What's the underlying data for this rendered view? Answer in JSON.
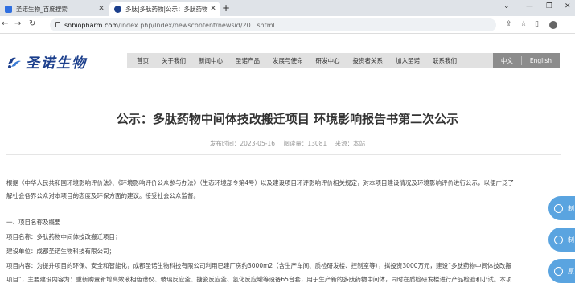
{
  "browser": {
    "tabs": [
      {
        "label": "圣诺生物_百度搜索",
        "icon": "baidu-favicon"
      },
      {
        "label": "多肽|多肽药物|公示：多肽药物中",
        "icon": "site-favicon"
      }
    ],
    "new_tab": "+",
    "url_host": "snbiopharm.com",
    "url_path": "/index.php/Index/newscontent/newsid/201.shtml",
    "colors": {
      "tabbar": "#dfe3e8",
      "active_tab": "#ffffff"
    }
  },
  "site": {
    "logo_text": "圣诺生物",
    "nav": [
      "首页",
      "关于我们",
      "新闻中心",
      "圣诺产品",
      "发展与使命",
      "研发中心",
      "投资者关系",
      "加入圣诺",
      "联系我们"
    ],
    "lang_cn": "中文",
    "lang_en": "English",
    "colors": {
      "brand": "#1c3f8c",
      "nav_bg": "#e1e1e1",
      "lang_bg": "#8c8c8c",
      "float_btn": "#5aa4e0"
    }
  },
  "article": {
    "title": "公示：多肽药物中间体技改搬迁项目 环境影响报告书第二次公示",
    "publish_time": "发布时间：2023-05-16",
    "views": "阅读量：13081",
    "source": "来源：本站",
    "paragraphs": [
      "根据《中华人民共和国环境影响评价法》、《环境影响评价公众参与办法》（生态环境部令第4号）以及建设项目环评影响评价相关规定，对本项目建设情况及环境影响评价进行公示，以便广泛了",
      "解社会各界公众对本项目的态度及环保方面的建议。接受社会公众监督。",
      "一、项目名称及概要",
      "项目名称：多肽药物中间体技改搬迁项目；",
      "建设单位：成都圣诺生物科技有限公司；",
      "项目内容：为提升项目的环保、安全和智能化，成都圣诺生物科技有限公司利用已建厂房约3000m2（含生产车间、质检研发楼、控制室等），拟投资3000万元，建设“多肽药物中间体技改搬",
      "项目”，主要建设内容为：重新购置新增高效液相色谱仪、玻璃反应釜、搪瓷反应釜、氢化反应罐等设备65台套，用于生产新的多肽药物中间体，同时在质检研发楼进行产品检验和小试。本项"
    ]
  },
  "floating": [
    {
      "label": "制",
      "icon": "chat-icon"
    },
    {
      "label": "制",
      "icon": "chat-icon"
    },
    {
      "label": "原",
      "icon": "chat-icon"
    }
  ]
}
